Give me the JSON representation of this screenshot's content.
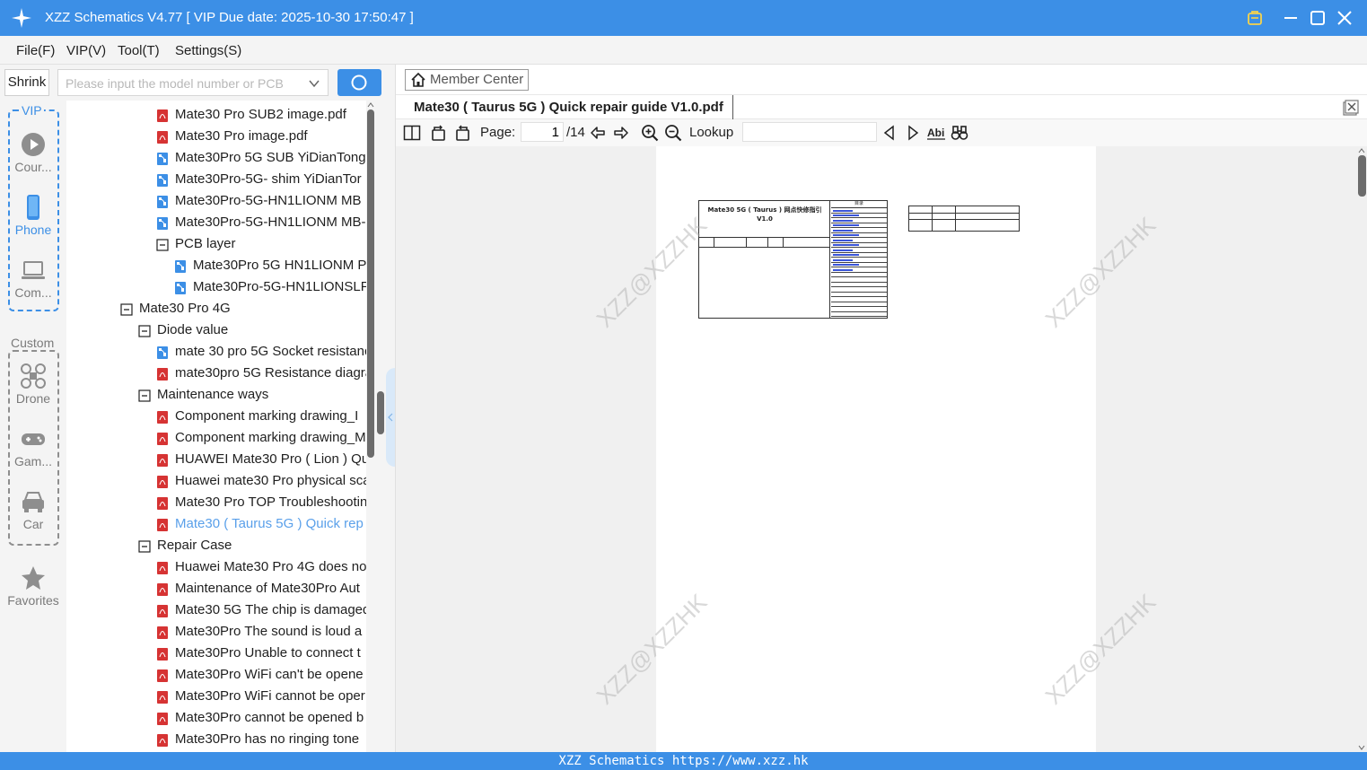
{
  "window": {
    "title": "XZZ Schematics V4.77 [ VIP Due date: 2025-10-30 17:50:47 ]"
  },
  "menu": [
    "File(F)",
    "VIP(V)",
    "Tool(T)",
    "Settings(S)"
  ],
  "left": {
    "shrink_label": "Shrink",
    "search_placeholder": "Please input the model number or PCB"
  },
  "rail": {
    "vip_label": "VIP",
    "custom_label": "Custom",
    "items": [
      "Cour...",
      "Phone",
      "Com...",
      "Drone",
      "Gam...",
      "Car",
      "Favorites"
    ]
  },
  "tree": [
    {
      "label": "Mate30 Pro SUB2 image.pdf",
      "type": "pdf",
      "level": 2
    },
    {
      "label": "Mate30 Pro image.pdf",
      "type": "pdf",
      "level": 2
    },
    {
      "label": "Mate30Pro 5G SUB YiDianTong",
      "type": "pcb",
      "level": 2
    },
    {
      "label": "Mate30Pro-5G- shim YiDianTor",
      "type": "pcb",
      "level": 2
    },
    {
      "label": "Mate30Pro-5G-HN1LIONM MB",
      "type": "pcb",
      "level": 2
    },
    {
      "label": "Mate30Pro-5G-HN1LIONM MB-",
      "type": "pcb",
      "level": 2
    },
    {
      "label": "PCB layer",
      "type": "folder",
      "level": 2
    },
    {
      "label": "Mate30Pro 5G HN1LIONM P",
      "type": "pcb",
      "level": 3
    },
    {
      "label": "Mate30Pro-5G-HN1LIONSLF",
      "type": "pcb",
      "level": 3
    },
    {
      "label": "Mate30 Pro 4G",
      "type": "folder",
      "level": 0
    },
    {
      "label": "Diode value",
      "type": "folder",
      "level": 1
    },
    {
      "label": "mate 30 pro 5G Socket resistanc",
      "type": "pcb",
      "level": 2
    },
    {
      "label": "mate30pro 5G Resistance diagra",
      "type": "pdf",
      "level": 2
    },
    {
      "label": "Maintenance ways",
      "type": "folder",
      "level": 1
    },
    {
      "label": "Component marking drawing_I",
      "type": "pdf",
      "level": 2
    },
    {
      "label": "Component marking drawing_M",
      "type": "pdf",
      "level": 2
    },
    {
      "label": "HUAWEI Mate30 Pro ( Lion ) Qu",
      "type": "pdf",
      "level": 2
    },
    {
      "label": "Huawei mate30 Pro physical sca",
      "type": "pdf",
      "level": 2
    },
    {
      "label": "Mate30 Pro TOP Troubleshootin",
      "type": "pdf",
      "level": 2
    },
    {
      "label": "Mate30 ( Taurus 5G ) Quick rep",
      "type": "pdf",
      "level": 2,
      "selected": true
    },
    {
      "label": "Repair Case",
      "type": "folder",
      "level": 1
    },
    {
      "label": "Huawei Mate30 Pro 4G does no",
      "type": "pdf",
      "level": 2
    },
    {
      "label": "Maintenance of Mate30Pro Aut",
      "type": "pdf",
      "level": 2
    },
    {
      "label": "Mate30 5G The chip is damaged",
      "type": "pdf",
      "level": 2
    },
    {
      "label": "Mate30Pro The sound is loud a",
      "type": "pdf",
      "level": 2
    },
    {
      "label": "Mate30Pro Unable to connect t",
      "type": "pdf",
      "level": 2
    },
    {
      "label": "Mate30Pro WiFi can't be opene",
      "type": "pdf",
      "level": 2
    },
    {
      "label": "Mate30Pro WiFi cannot be oper",
      "type": "pdf",
      "level": 2
    },
    {
      "label": "Mate30Pro cannot be opened b",
      "type": "pdf",
      "level": 2
    },
    {
      "label": "Mate30Pro has no ringing tone",
      "type": "pdf",
      "level": 2
    }
  ],
  "right": {
    "member_center": "Member Center",
    "tab_title": "Mate30 ( Taurus 5G ) Quick repair guide V1.0.pdf",
    "toolbar": {
      "page_label": "Page:",
      "page_value": "1",
      "page_total": "/14",
      "lookup_label": "Lookup"
    },
    "doc": {
      "heading": "Mate30 5G ( Taurus ) 网点快修指引",
      "version": "V1.0",
      "toc_title": "目录"
    },
    "watermark": "XZZ@XZZHK"
  },
  "status": "XZZ Schematics https://www.xzz.hk",
  "colors": {
    "accent": "#3c8fe6",
    "pdf_icon": "#d63333",
    "pcb_icon": "#3c8fe6",
    "selected_text": "#5aa0ea"
  }
}
